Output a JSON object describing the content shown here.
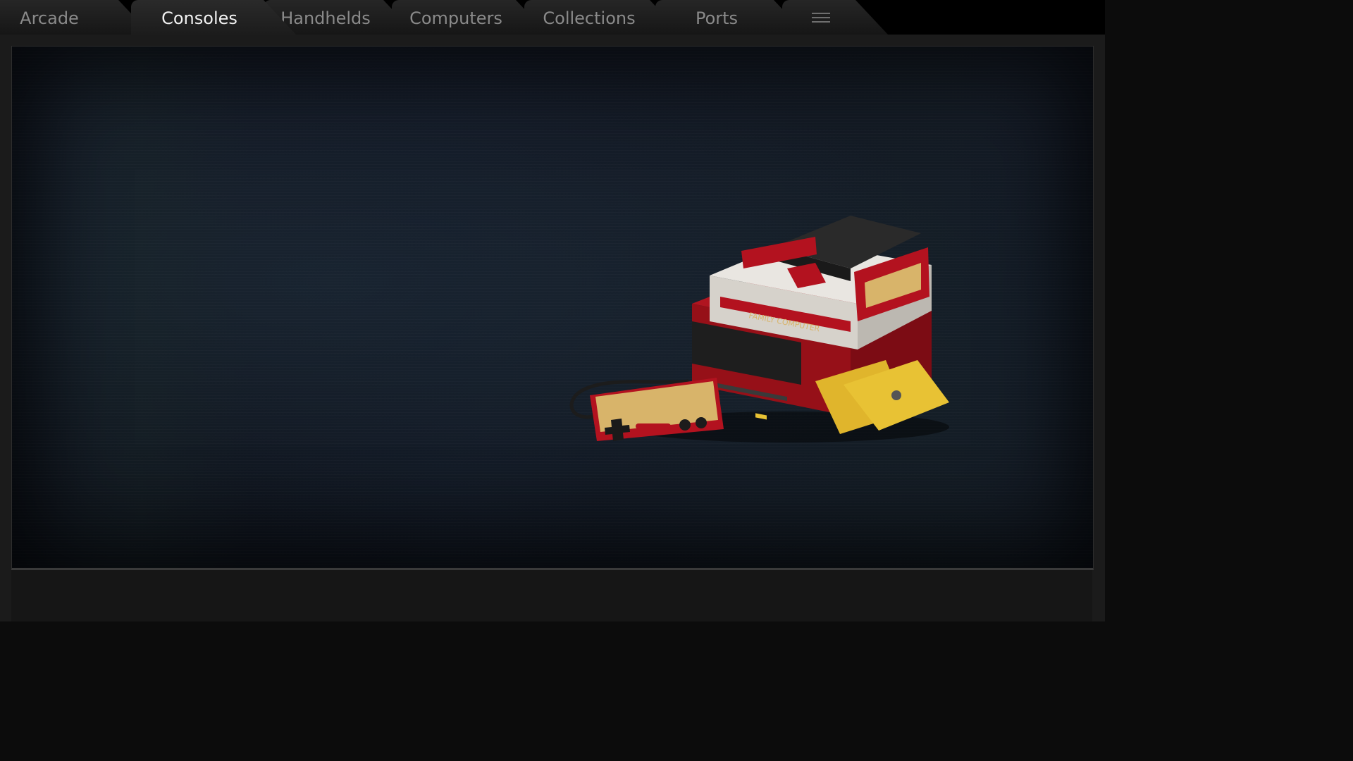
{
  "tabs": [
    {
      "label": "Arcade",
      "active": false
    },
    {
      "label": "Consoles",
      "active": true
    },
    {
      "label": "Handhelds",
      "active": false
    },
    {
      "label": "Computers",
      "active": false
    },
    {
      "label": "Collections",
      "active": false
    },
    {
      "label": "Ports",
      "active": false
    }
  ],
  "menu": {
    "icon": "hamburger-menu-icon"
  },
  "preview": {
    "image": "famicom-disk-system-console",
    "brand_text": "FAMILY COMPUTER",
    "accent_colors": {
      "red": "#b3121f",
      "white": "#e9e6e1",
      "gold": "#d8b46a",
      "disk_yellow": "#e8c234"
    }
  }
}
